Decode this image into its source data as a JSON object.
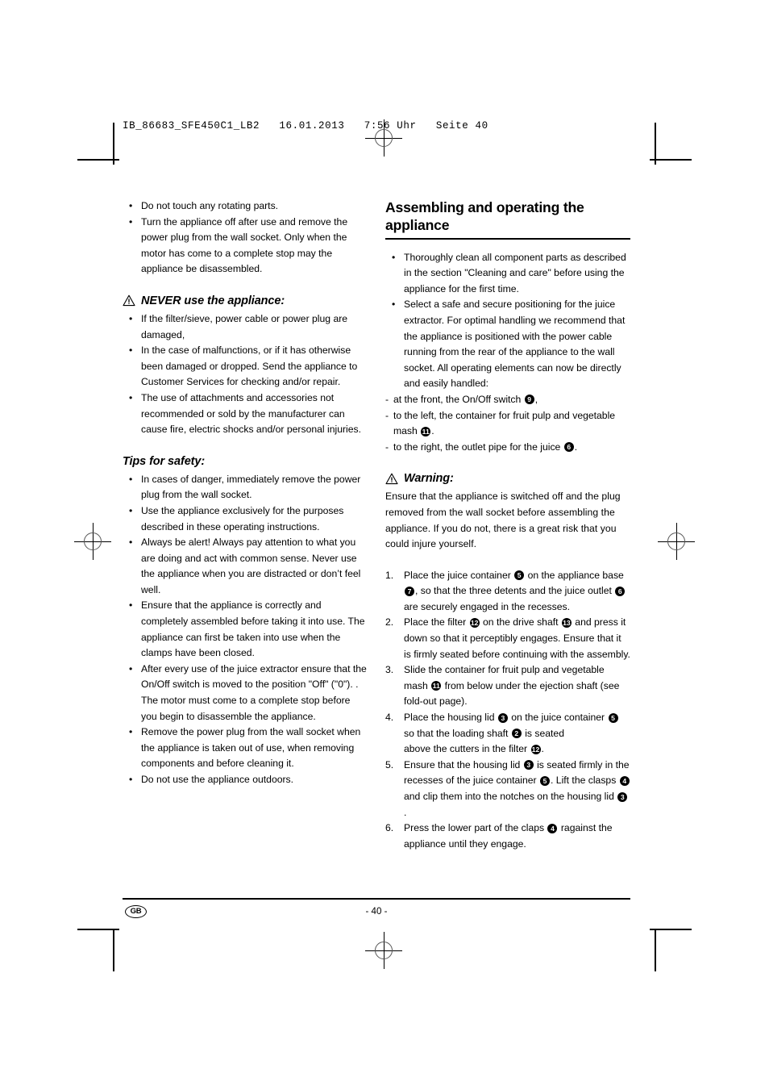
{
  "document": {
    "slug": "IB_86683_SFE450C1_LB2   16.01.2013   7:56 Uhr   Seite 40",
    "footer": {
      "locale_badge": "GB",
      "page_number": "- 40 -"
    }
  },
  "left_column": {
    "top_bullets": [
      "Do not touch any rotating parts.",
      "Turn the appliance off after use and remove the power plug from the wall socket. Only when the motor has come to a complete stop may the appliance be disassembled."
    ],
    "never_section": {
      "icon": "warning-triangle-icon",
      "heading": "NEVER use the appliance:",
      "bullets": [
        "If the filter/sieve, power cable or power plug are damaged,",
        "In the case of malfunctions, or if it has otherwise been damaged or dropped. Send the appliance to Customer Services for checking and/or repair.",
        "The use of attachments and accessories not recommended or sold by the manufacturer can cause fire, electric shocks and/or personal injuries."
      ]
    },
    "tips_section": {
      "heading": "Tips for safety:",
      "bullets": [
        "In cases of danger, immediately remove the power plug from the wall socket.",
        "Use the appliance exclusively for the purposes described in these operating instructions.",
        "Always be alert! Always pay attention to what you are doing and act with common sense. Never use the appliance when you are distracted or don’t feel well.",
        "Ensure that the appliance is correctly and completely assembled before taking it into use. The appliance can first be taken into use when the clamps have been closed.",
        "After every use of the juice extractor ensure that the On/Off switch is moved to the position \"Off\" (\"0\"). . The motor must come to a complete stop before you begin to disassemble the appliance.",
        "Remove the power plug from the wall socket when the appliance is taken out of use, when removing components and before cleaning it.",
        "Do not use the appliance outdoors."
      ]
    }
  },
  "right_column": {
    "section_heading": "Assembling and operating the appliance",
    "intro_bullets": [
      {
        "parts": [
          {
            "t": "text",
            "v": "Thoroughly clean all component parts as described in the section \"Cleaning and care\" before using the appliance for the first time."
          }
        ]
      },
      {
        "parts": [
          {
            "t": "text",
            "v": " Select a safe and secure positioning for the juice extractor. For optimal handling we recommend that the appliance is positioned with the power cable running from the rear of the appliance to the wall socket. All operating elements can now be directly and easily handled:"
          }
        ]
      }
    ],
    "sub_items": [
      {
        "parts": [
          {
            "t": "text",
            "v": "at the front, the On/Off switch "
          },
          {
            "t": "badge",
            "v": "9"
          },
          {
            "t": "text",
            "v": ","
          }
        ]
      },
      {
        "parts": [
          {
            "t": "text",
            "v": "to the left, the container for fruit pulp and vegetable mash "
          },
          {
            "t": "badge",
            "v": "11"
          },
          {
            "t": "text",
            "v": "."
          }
        ]
      },
      {
        "parts": [
          {
            "t": "text",
            "v": "to the right, the outlet pipe for the juice "
          },
          {
            "t": "badge",
            "v": "6"
          },
          {
            "t": "text",
            "v": "."
          }
        ]
      }
    ],
    "warning": {
      "icon": "warning-triangle-icon",
      "heading": "Warning:",
      "text": "Ensure that the appliance is switched off and the plug removed from the wall socket before assembling the appliance. If you do not, there is a great risk that you could injure yourself."
    },
    "steps": [
      {
        "number": "1.",
        "parts": [
          {
            "t": "text",
            "v": "Place the juice container "
          },
          {
            "t": "badge",
            "v": "5"
          },
          {
            "t": "text",
            "v": " on the appliance base "
          },
          {
            "t": "badge",
            "v": "7"
          },
          {
            "t": "text",
            "v": ", so that the three detents and the juice outlet "
          },
          {
            "t": "badge",
            "v": "6"
          },
          {
            "t": "text",
            "v": " are securely engaged in the recesses."
          }
        ]
      },
      {
        "number": "2.",
        "parts": [
          {
            "t": "text",
            "v": "Place the filter "
          },
          {
            "t": "badge",
            "v": "12"
          },
          {
            "t": "text",
            "v": " on the drive shaft "
          },
          {
            "t": "badge",
            "v": "13"
          },
          {
            "t": "text",
            "v": " and press it down so that it perceptibly engages. Ensure that it is firmly seated before continuing with the assembly."
          }
        ]
      },
      {
        "number": "3.",
        "parts": [
          {
            "t": "text",
            "v": "Slide the container for fruit pulp and vegetable mash "
          },
          {
            "t": "badge",
            "v": "11"
          },
          {
            "t": "text",
            "v": " from below under the ejection shaft (see fold-out page)."
          }
        ]
      },
      {
        "number": "4.",
        "parts": [
          {
            "t": "text",
            "v": "Place the housing lid "
          },
          {
            "t": "badge",
            "v": "3"
          },
          {
            "t": "text",
            "v": " on the juice container "
          },
          {
            "t": "badge",
            "v": "5"
          },
          {
            "t": "text",
            "v": " so that the loading shaft "
          },
          {
            "t": "badge",
            "v": "2"
          },
          {
            "t": "text",
            "v": " is seated"
          },
          {
            "t": "break",
            "v": ""
          },
          {
            "t": "text",
            "v": "above the cutters in the filter "
          },
          {
            "t": "badge",
            "v": "12"
          },
          {
            "t": "text",
            "v": "."
          }
        ]
      },
      {
        "number": "5.",
        "parts": [
          {
            "t": "text",
            "v": "Ensure that the housing lid "
          },
          {
            "t": "badge",
            "v": "3"
          },
          {
            "t": "text",
            "v": " is seated firmly in the recesses of the juice container "
          },
          {
            "t": "badge",
            "v": "5"
          },
          {
            "t": "text",
            "v": ". Lift the clasps "
          },
          {
            "t": "badge",
            "v": "4"
          },
          {
            "t": "text",
            "v": " and clip them into the notches on the housing lid "
          },
          {
            "t": "badge",
            "v": "3"
          },
          {
            "t": "text",
            "v": "."
          }
        ]
      },
      {
        "number": "6.",
        "parts": [
          {
            "t": "text",
            "v": "Press the lower part of the claps "
          },
          {
            "t": "badge",
            "v": "4"
          },
          {
            "t": "text",
            "v": "  ragainst the appliance until they engage."
          }
        ]
      }
    ]
  }
}
